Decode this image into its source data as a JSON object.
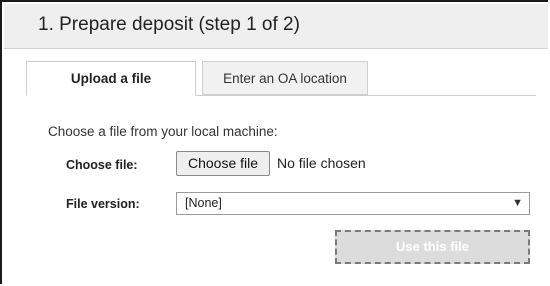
{
  "header": {
    "title": "1. Prepare deposit (step 1 of 2)"
  },
  "tabs": [
    {
      "label": "Upload a file",
      "active": true
    },
    {
      "label": "Enter an OA location",
      "active": false
    }
  ],
  "upload": {
    "instruction": "Choose a file from your local machine:",
    "choose_file_label": "Choose file:",
    "choose_file_button": "Choose file",
    "no_file_text": "No file chosen",
    "file_version_label": "File version:",
    "file_version_value": "[None]",
    "dropdown_arrow": "▼",
    "use_button": "Use this file",
    "use_button_enabled": false
  },
  "colors": {
    "header_bg": "#efefef",
    "frame_border": "#1a1a1a",
    "disabled_button_bg": "#dcdcdc"
  }
}
